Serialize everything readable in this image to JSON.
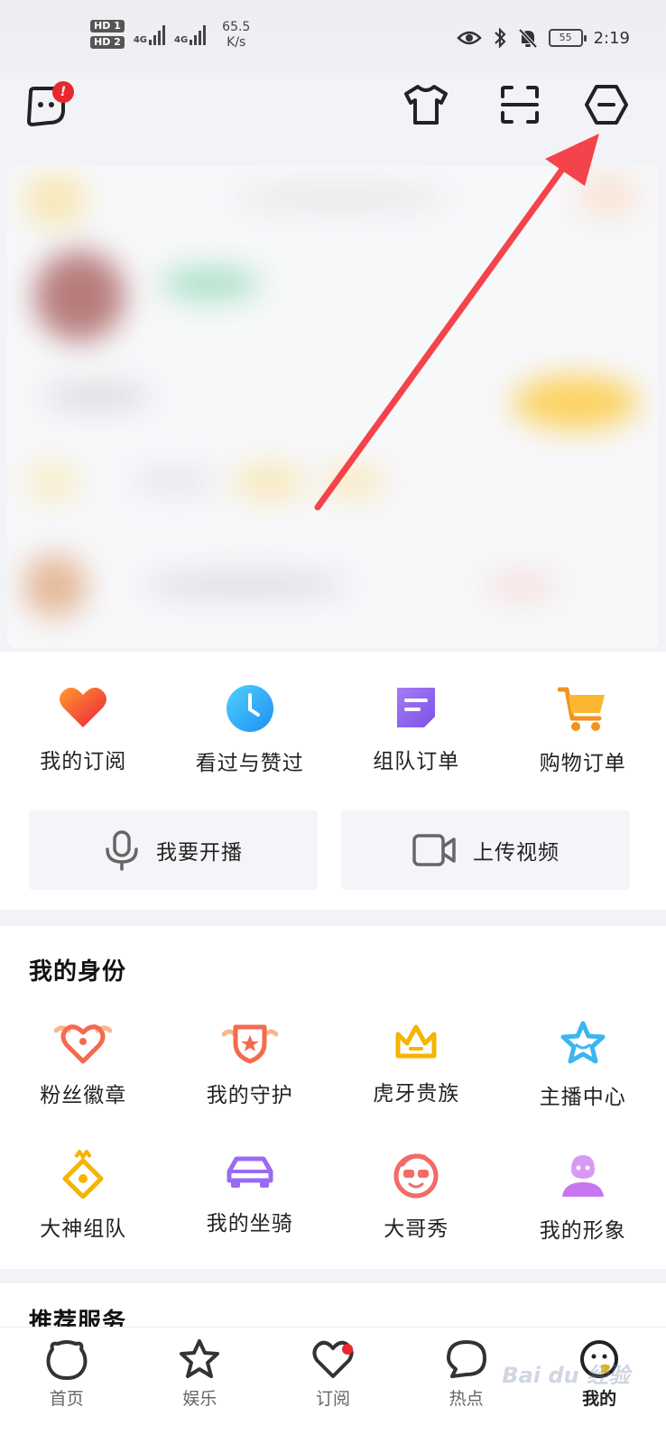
{
  "status_bar": {
    "sim1": "HD 1",
    "sim2": "HD 2",
    "net1": "4G",
    "net2": "4G",
    "speed_value": "65.5",
    "speed_unit": "K/s",
    "battery": "55",
    "time": "2:19"
  },
  "top_bar": {
    "notification_badge": "!",
    "icons": [
      "chat-face-icon",
      "tshirt-icon",
      "scan-icon",
      "settings-hexagon-icon"
    ]
  },
  "quick_actions": [
    {
      "label": "我的订阅",
      "icon": "heart-icon",
      "color": "#f03a3a"
    },
    {
      "label": "看过与赞过",
      "icon": "clock-icon",
      "color": "#2aa8f2"
    },
    {
      "label": "组队订单",
      "icon": "note-icon",
      "color": "#8b63ec"
    },
    {
      "label": "购物订单",
      "icon": "cart-icon",
      "color": "#f5a623"
    }
  ],
  "wide_buttons": {
    "broadcast": "我要开播",
    "upload": "上传视频"
  },
  "identity": {
    "title": "我的身份",
    "items": [
      {
        "label": "粉丝徽章",
        "icon": "fan-badge-icon"
      },
      {
        "label": "我的守护",
        "icon": "guard-shield-icon"
      },
      {
        "label": "虎牙贵族",
        "icon": "crown-icon"
      },
      {
        "label": "主播中心",
        "icon": "star-face-icon"
      },
      {
        "label": "大神组队",
        "icon": "team-badge-icon"
      },
      {
        "label": "我的坐骑",
        "icon": "car-icon"
      },
      {
        "label": "大哥秀",
        "icon": "big-brother-icon"
      },
      {
        "label": "我的形象",
        "icon": "avatar-figure-icon"
      }
    ]
  },
  "recommend": {
    "title": "推荐服务"
  },
  "tabs": [
    {
      "label": "首页",
      "icon": "home-icon",
      "active": false
    },
    {
      "label": "娱乐",
      "icon": "entertainment-icon",
      "active": false
    },
    {
      "label": "订阅",
      "icon": "subscribe-heart-icon",
      "active": false,
      "dot": true
    },
    {
      "label": "热点",
      "icon": "hot-chat-icon",
      "active": false
    },
    {
      "label": "我的",
      "icon": "me-face-icon",
      "active": true
    }
  ],
  "watermark": "Bai du 经验"
}
